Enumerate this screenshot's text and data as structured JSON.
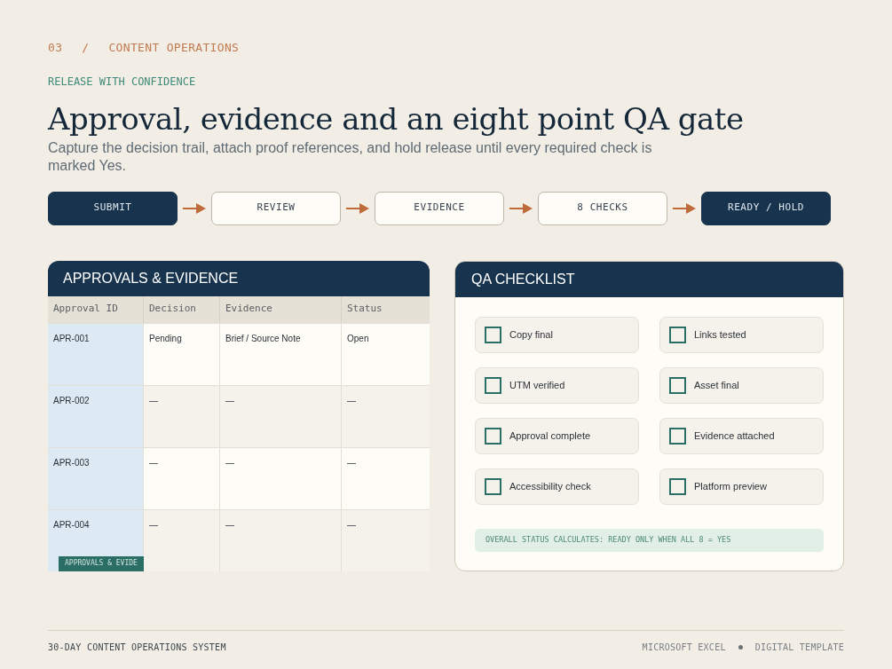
{
  "eyebrow": {
    "number": "03",
    "separator": "/",
    "section": "CONTENT OPERATIONS"
  },
  "tagline": "RELEASE WITH CONFIDENCE",
  "title": "Approval, evidence and an eight point QA gate",
  "subtitle": "Capture the decision trail, attach proof references, and hold release until every required check is marked Yes.",
  "flow": [
    {
      "label": "SUBMIT",
      "kind": "filled"
    },
    {
      "label": "REVIEW",
      "kind": "outline"
    },
    {
      "label": "EVIDENCE",
      "kind": "outline"
    },
    {
      "label": "8 CHECKS",
      "kind": "outline"
    },
    {
      "label": "READY / HOLD",
      "kind": "filled"
    }
  ],
  "approvals": {
    "title": "APPROVALS & EVIDENCE",
    "columns": [
      "Approval ID",
      "Decision",
      "Evidence",
      "Status"
    ],
    "rows": [
      [
        "APR-001",
        "Pending",
        "Brief / Source Note",
        "Open"
      ],
      [
        "APR-002",
        "—",
        "—",
        "—"
      ],
      [
        "APR-003",
        "—",
        "—",
        "—"
      ],
      [
        "APR-004",
        "—",
        "—",
        "—"
      ]
    ],
    "sheet_tab": "APPROVALS & EVIDE"
  },
  "checklist": {
    "title": "QA CHECKLIST",
    "items": [
      {
        "label": "Copy final",
        "checked": false
      },
      {
        "label": "Links tested",
        "checked": false
      },
      {
        "label": "UTM verified",
        "checked": false
      },
      {
        "label": "Asset final",
        "checked": false
      },
      {
        "label": "Approval complete",
        "checked": false
      },
      {
        "label": "Evidence attached",
        "checked": false
      },
      {
        "label": "Accessibility check",
        "checked": false
      },
      {
        "label": "Platform preview",
        "checked": false
      }
    ],
    "note": "OVERALL STATUS CALCULATES: READY ONLY WHEN ALL 8 = YES"
  },
  "footer": {
    "left": "30-DAY CONTENT OPERATIONS SYSTEM",
    "right": [
      "MICROSOFT EXCEL",
      "DIGITAL TEMPLATE"
    ]
  }
}
